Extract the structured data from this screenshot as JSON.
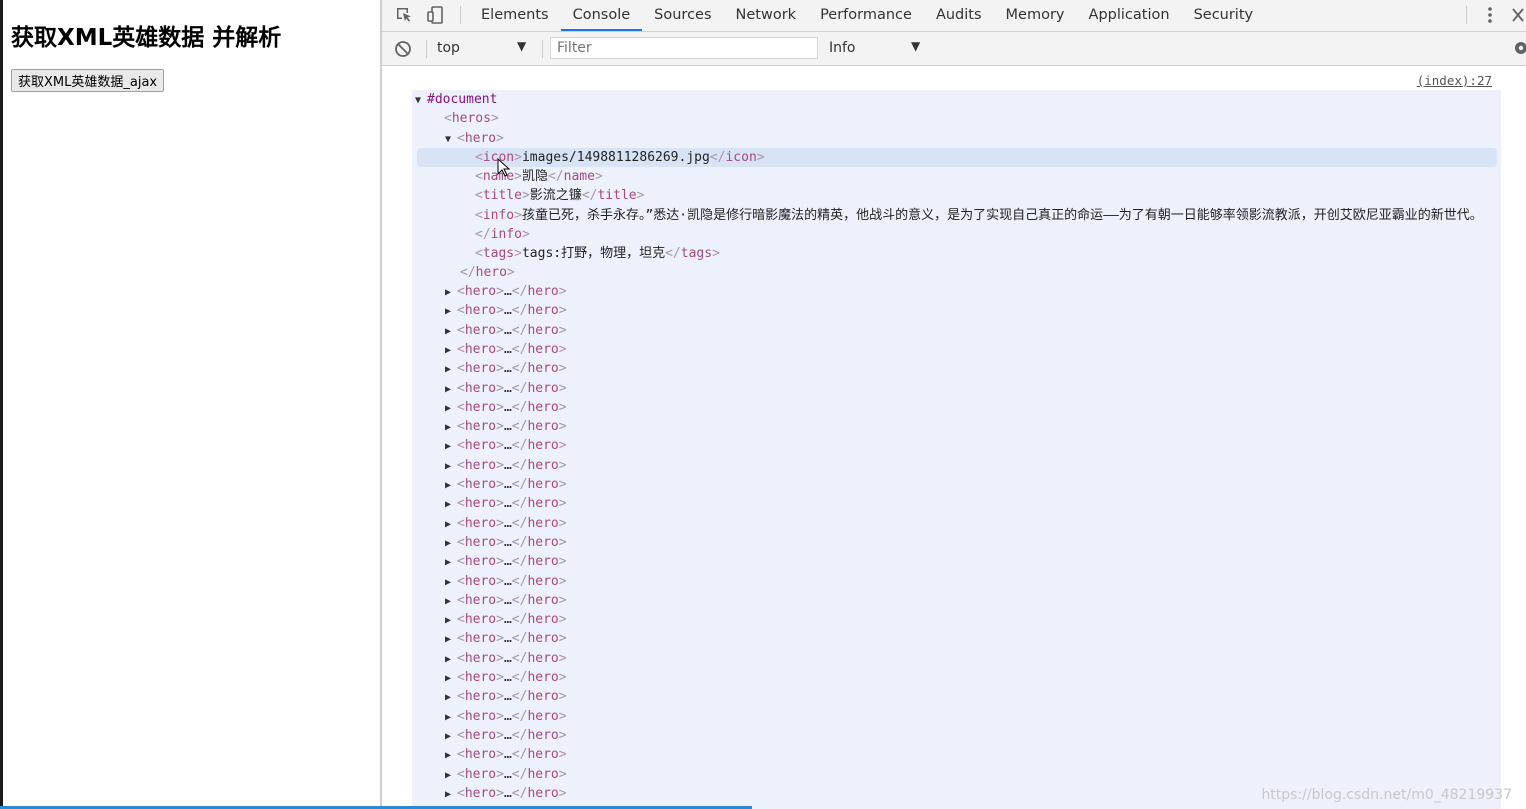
{
  "page": {
    "heading": "获取XML英雄数据 并解析",
    "button_label": "获取XML英雄数据_ajax"
  },
  "devtools": {
    "tabs": [
      {
        "label": "Elements"
      },
      {
        "label": "Console",
        "active": true
      },
      {
        "label": "Sources"
      },
      {
        "label": "Network"
      },
      {
        "label": "Performance"
      },
      {
        "label": "Audits"
      },
      {
        "label": "Memory"
      },
      {
        "label": "Application"
      },
      {
        "label": "Security"
      }
    ],
    "toolbar": {
      "context": "top",
      "filter_placeholder": "Filter",
      "level": "Info"
    },
    "console": {
      "source_link": "(index):27",
      "document": "#document",
      "heros_tag": "heros",
      "hero_tag": "hero",
      "icon": {
        "tag": "icon",
        "value": "images/1498811286269.jpg"
      },
      "name": {
        "tag": "name",
        "value": "凯隐"
      },
      "title": {
        "tag": "title",
        "value": "影流之镰"
      },
      "info": {
        "tag": "info",
        "value": "孩童已死，杀手永存。”悉达·凯隐是修行暗影魔法的精英，他战斗的意义，是为了实现自己真正的命运——为了有朝一日能够率领影流教派，开创艾欧尼亚霸业的新世代。"
      },
      "tags": {
        "tag": "tags",
        "value": "tags:打野，物理，坦克"
      },
      "collapsed_hero_count": 27,
      "ellipsis": "…"
    },
    "watermark": "https://blog.csdn.net/m0_48219937"
  },
  "colors": {
    "tag": "#a8497f",
    "active_tab_underline": "#1a73e8",
    "tree_background": "#ecf1fb"
  }
}
